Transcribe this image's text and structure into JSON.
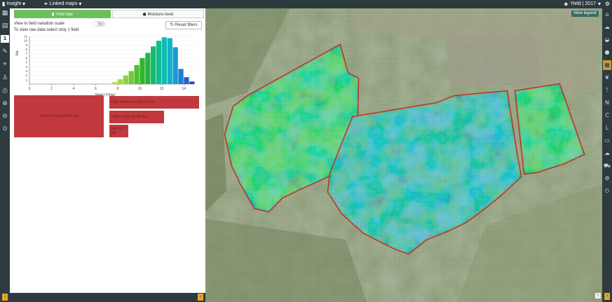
{
  "topbar": {
    "insight_label": "Insight",
    "linked_maps_label": "Linked maps",
    "context_label": "Yield | 2017"
  },
  "panel": {
    "yield_rate_label": "Yield rate",
    "moisture_level_label": "Moisture level",
    "variation_label": "View in field variation scale",
    "switch_label": "No",
    "raw_note": "To view raw data select only 1 field",
    "reset_label": "Reset filters"
  },
  "histogram_axis": {
    "xlabel": "Yield (T/Ha)",
    "ylabel": "Ha",
    "xticks": [
      "0",
      "2",
      "4",
      "6",
      "8",
      "10",
      "12",
      "14"
    ],
    "yticks": [
      "1",
      "2",
      "3",
      "4",
      "5",
      "6",
      "7",
      "8",
      "9",
      "10",
      "11"
    ]
  },
  "chart_data": {
    "type": "bar",
    "xlabel": "Yield (T/Ha)",
    "ylabel": "Ha",
    "xlim": [
      0,
      15
    ],
    "ylim": [
      0,
      11
    ],
    "bin_width": 0.5,
    "bins": [
      {
        "x": 7.5,
        "y": 0.5,
        "color": "#b8e04a"
      },
      {
        "x": 8.0,
        "y": 1.1,
        "color": "#a6db3e"
      },
      {
        "x": 8.5,
        "y": 2.0,
        "color": "#8fd43a"
      },
      {
        "x": 9.0,
        "y": 3.0,
        "color": "#70ca35"
      },
      {
        "x": 9.5,
        "y": 4.4,
        "color": "#4fc130"
      },
      {
        "x": 10.0,
        "y": 6.0,
        "color": "#2fb72c"
      },
      {
        "x": 10.5,
        "y": 7.2,
        "color": "#22b545"
      },
      {
        "x": 11.0,
        "y": 8.7,
        "color": "#1ab96a"
      },
      {
        "x": 11.5,
        "y": 10.0,
        "color": "#12bc93"
      },
      {
        "x": 12.0,
        "y": 10.8,
        "color": "#0fbcb4"
      },
      {
        "x": 12.5,
        "y": 10.6,
        "color": "#12b2cc"
      },
      {
        "x": 13.0,
        "y": 8.5,
        "color": "#1a9bd4"
      },
      {
        "x": 13.5,
        "y": 3.5,
        "color": "#1e7fd0"
      },
      {
        "x": 14.0,
        "y": 1.6,
        "color": "#2462c4"
      },
      {
        "x": 14.5,
        "y": 0.6,
        "color": "#2a4cb8"
      }
    ]
  },
  "treemap": {
    "crop": {
      "label": "Winter Wheat (84.94 Ha)",
      "value": 84.94
    },
    "fields": [
      {
        "label": "High Street Lane (45.72 Ha)",
        "value": 45.72
      },
      {
        "label": "Chalk Chalk (28.44 Ha)",
        "value": 28.44
      },
      {
        "label": "Ball (9.77 Ha)",
        "value": 9.77
      }
    ]
  },
  "map": {
    "view_legend_label": "View legend"
  },
  "colors": {
    "toolbar": "#2d3b3f",
    "accent": "#6cbf5a",
    "treemap_block": "#c1393e",
    "field_border": "#b42a24"
  }
}
